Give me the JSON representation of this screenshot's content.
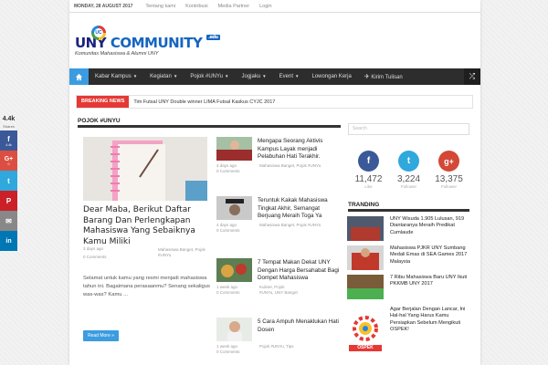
{
  "topbar": {
    "date": "MONDAY, 28 AUGUST 2017",
    "links": [
      "Tentang kami",
      "Kontribusi",
      "Media Partner",
      "Login"
    ]
  },
  "logo": {
    "mark": "UC",
    "name_a": "UNY ",
    "name_b": "COMMUNITY",
    "edu": ".edu",
    "tagline": "Komunitas Mahasiswa & Alumni UNY"
  },
  "nav": {
    "items": [
      "Kabar Kampus",
      "Kegiatan",
      "Pojok #UNYu",
      "Jogjaku",
      "Event",
      "Lowongan Kerja",
      "Kirim Tulisan"
    ],
    "has_caret": [
      true,
      true,
      true,
      true,
      true,
      false,
      false
    ]
  },
  "ticker": {
    "label": "BREAKING NEWS",
    "text": "Tim Futsal UNY Double winner LIMA Futsal Kaskus CYJC 2017"
  },
  "section": {
    "title": "POJOK #UNYU"
  },
  "featured": {
    "title": "Dear Maba, Berikut Daftar Barang Dan Perlengkapan Mahasiswa Yang Sebaiknya Kamu Miliki",
    "date": "3 days ago",
    "categories": "Mahasiswa Banget, Pojok #UNYu",
    "comments": "0 Comments",
    "excerpt": "Selamat untuk kamu yang resmi menjadi mahasiswa tahun ini. Bagaimana perasaanmu? Senang sekaligus was-was? Kamu ...",
    "read_more": "Read More »"
  },
  "posts": [
    {
      "title": "Mengapa Seorang Aktivis Kampus Layak menjadi Pelabuhan Hati Terakhir.",
      "date": "4 days ago",
      "categories": "Mahasiswa Banget, Pojok #UNYu",
      "comments": "0 Comments"
    },
    {
      "title": "Teruntuk Kakak Mahasiswa Tingkat Akhir, Semangat Berjuang Meraih Toga Ya",
      "date": "4 days ago",
      "categories": "Mahasiswa Banget, Pojok #UNYu",
      "comments": "0 Comments"
    },
    {
      "title": "7 Tempat Makan Dekat UNY Dengan Harga Bersahabat Bagi Dompet Mahasiswa",
      "date": "1 week ago",
      "categories": "Kuliner, Pojok #UNYu, UNY Banget",
      "comments": "0 Comments"
    },
    {
      "title": "5 Cara Ampuh Menaklukan Hati Dosen",
      "date": "1 week ago",
      "categories": "Pojok #UNYu, Tips",
      "comments": "0 Comments"
    }
  ],
  "sidebar": {
    "search_placeholder": "Search",
    "social": [
      {
        "icon": "facebook-icon",
        "glyph": "f",
        "count": "11,472",
        "unit": "Like",
        "color": "#3b5998"
      },
      {
        "icon": "twitter-icon",
        "glyph": "t",
        "count": "3,224",
        "unit": "Follower",
        "color": "#2fa8dd"
      },
      {
        "icon": "googleplus-icon",
        "glyph": "g+",
        "count": "13,375",
        "unit": "Follower",
        "color": "#d34836"
      }
    ],
    "tranding_title": "TRANDING",
    "tranding": [
      "UNY Wisuda 1.905 Lulusan, 919 Diantaranya Meraih Predikat Cumlaude",
      "Mahasiswa PJKR UNY Sumbang Medali Emas di SEA Games 2017 Malaysia",
      "7 Ribu Mahasiswa Baru UNY Ikuti PKKMB UNY 2017",
      "Agar Berjalan Dengan Lancar, Ini Hal-hal Yang Harus Kamu Persiapkan Sebelum Mengikuti OSPEK!"
    ],
    "ospek_text": "OSPEK"
  },
  "share": {
    "count": "4.4k",
    "unit": "Shares",
    "buttons": [
      {
        "icon": "facebook-icon",
        "glyph": "f",
        "sub": "4.4k",
        "color": "#3b5998"
      },
      {
        "icon": "googleplus-icon",
        "glyph": "G+",
        "sub": "0",
        "color": "#dc4e41"
      },
      {
        "icon": "twitter-icon",
        "glyph": "t",
        "sub": "",
        "color": "#2fa8dd"
      },
      {
        "icon": "pinterest-icon",
        "glyph": "P",
        "sub": "",
        "color": "#cb2027"
      },
      {
        "icon": "email-icon",
        "glyph": "✉",
        "sub": "",
        "color": "#888"
      },
      {
        "icon": "linkedin-icon",
        "glyph": "in",
        "sub": "",
        "color": "#0077b5"
      }
    ]
  }
}
